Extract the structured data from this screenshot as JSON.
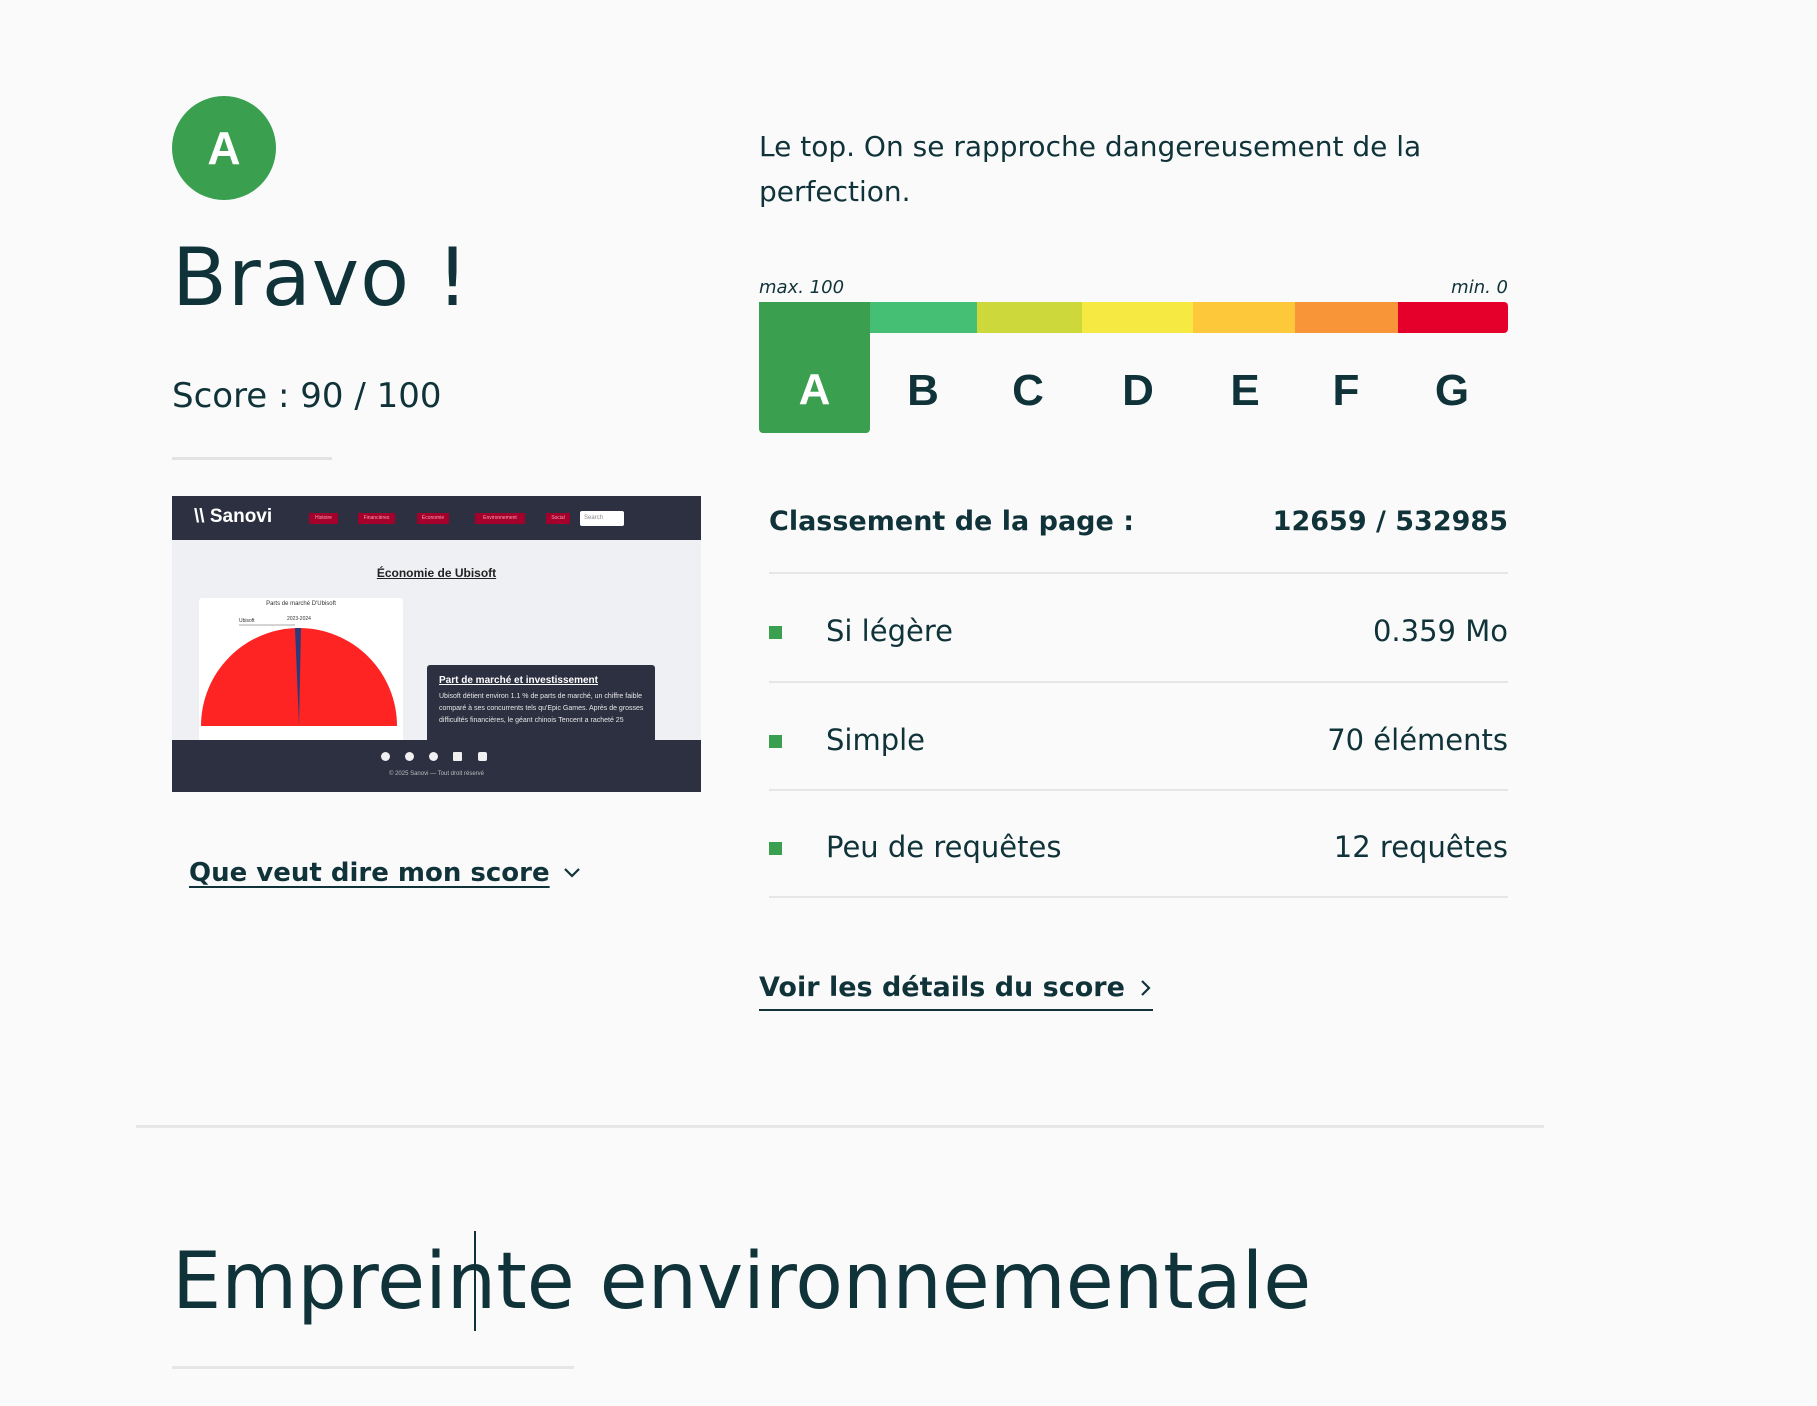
{
  "grade": {
    "letter": "A",
    "color": "#3a9f4f"
  },
  "heading": "Bravo !",
  "score_text": "Score : 90 / 100",
  "description": "Le top. On se rapproche dangereusement de la perfection.",
  "scale": {
    "max_label": "max. 100",
    "min_label": "min. 0",
    "active": "A",
    "grades": [
      {
        "letter": "A",
        "color": "#3a9f4f"
      },
      {
        "letter": "B",
        "color": "#45bf74"
      },
      {
        "letter": "C",
        "color": "#cdd93a"
      },
      {
        "letter": "D",
        "color": "#f5e942"
      },
      {
        "letter": "E",
        "color": "#fdc93a"
      },
      {
        "letter": "F",
        "color": "#f99539"
      },
      {
        "letter": "G",
        "color": "#e5002b"
      }
    ]
  },
  "thumbnail": {
    "brand": "Sanovi",
    "nav_items": [
      "Histoire",
      "Financières",
      "Économie",
      "Environnement",
      "Social"
    ],
    "search_placeholder": "Search",
    "page_title": "Économie de Ubisoft",
    "chart_title": "Parts de marché D'Ubisoft",
    "chart_legend_year": "2023-2024",
    "chart_label": "Ubisoft",
    "info_title": "Part de marché et investissement",
    "info_text": "Ubisoft détient environ 1.1 % de parts de marché, un chiffre faible comparé à ses concurrents tels qu'Epic Games. Après de grosses difficultés financières, le géant chinois Tencent a racheté 25",
    "footer_text": "© 2025 Sanovi — Tout droit réservé"
  },
  "score_link": "Que veut dire mon score",
  "ranking": {
    "label": "Classement de la page :",
    "value": "12659 / 532985"
  },
  "metrics": [
    {
      "label": "Si légère",
      "value": "0.359 Mo"
    },
    {
      "label": "Simple",
      "value": "70 éléments"
    },
    {
      "label": "Peu de requêtes",
      "value": "12 requêtes"
    }
  ],
  "details_link": "Voir les détails du score",
  "section_title": "Empreinte environnementale",
  "colors": {
    "text": "#0f3339",
    "background": "#fafafa",
    "accent": "#3a9f4f"
  }
}
